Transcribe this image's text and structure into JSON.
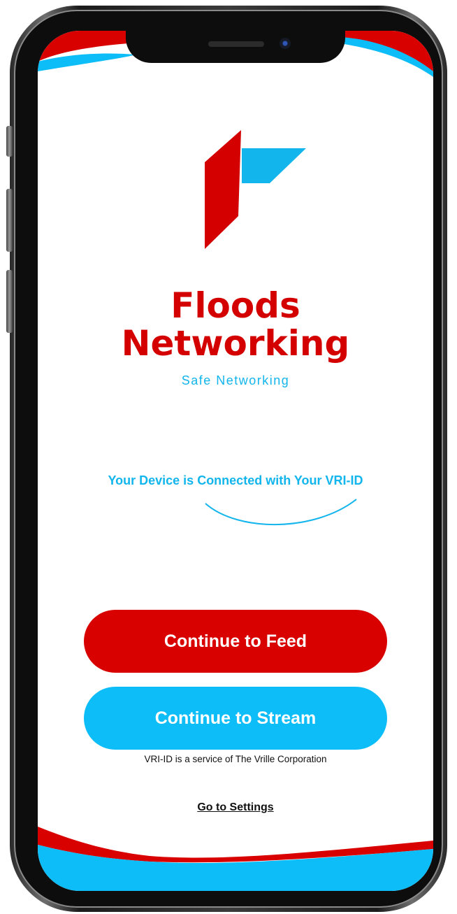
{
  "app": {
    "brand_title_line1": "Floods",
    "brand_title_line2": "Networking",
    "tagline": "Safe Networking"
  },
  "status": {
    "message": "Your Device is Connected with Your VRI-ID"
  },
  "actions": {
    "feed_label": "Continue to Feed",
    "stream_label": "Continue to Stream",
    "settings_label": "Go to Settings"
  },
  "footer": {
    "note": "VRI-ID is a service of The Vrille Corporation"
  },
  "colors": {
    "brand_red": "#d90000",
    "brand_blue": "#0dbdf7"
  },
  "icons": {
    "logo": "floods-logo-icon"
  }
}
